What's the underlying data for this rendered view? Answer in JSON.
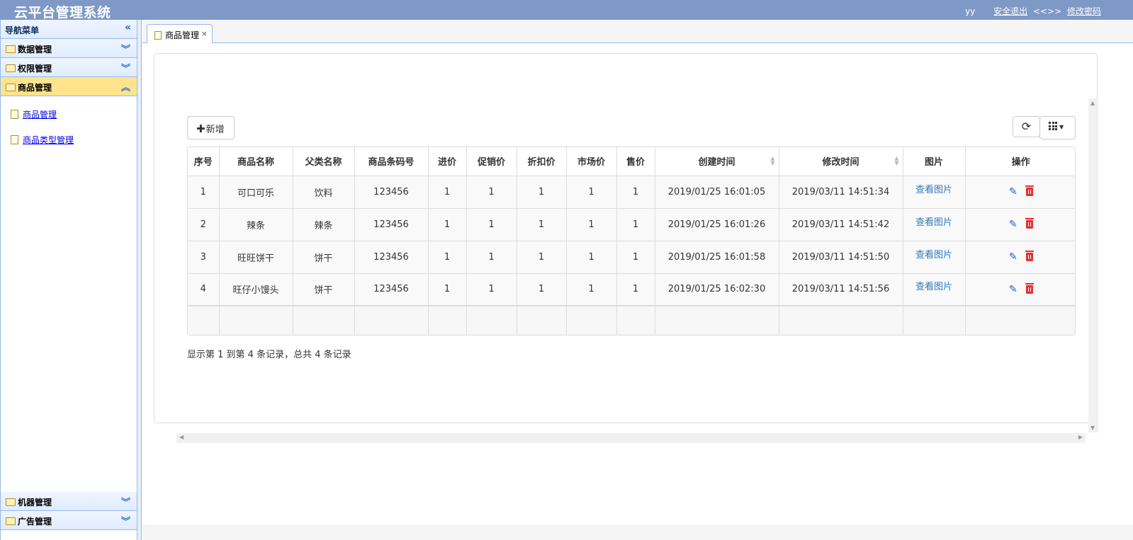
{
  "header": {
    "title": "云平台管理系统",
    "user": "yy",
    "logout": "安全退出",
    "separator": "<<>>",
    "change_password": "修改密码"
  },
  "sidebar": {
    "heading": "导航菜单",
    "sections": [
      {
        "label": "数据管理",
        "state": "collapsed"
      },
      {
        "label": "权限管理",
        "state": "collapsed"
      },
      {
        "label": "商品管理",
        "state": "expanded"
      },
      {
        "label": "机器管理",
        "state": "collapsed"
      },
      {
        "label": "广告管理",
        "state": "collapsed"
      }
    ],
    "items": [
      "商品管理",
      "商品类型管理"
    ]
  },
  "tabs": [
    {
      "label": "商品管理"
    }
  ],
  "toolbar": {
    "add_label": "新增"
  },
  "table": {
    "columns": [
      "序号",
      "商品名称",
      "父类名称",
      "商品条码号",
      "进价",
      "促销价",
      "折扣价",
      "市场价",
      "售价",
      "创建时间",
      "修改时间",
      "图片",
      "操作"
    ],
    "rows": [
      {
        "no": "1",
        "name": "可口可乐",
        "parent": "饮料",
        "barcode": "123456",
        "cost": "1",
        "promo": "1",
        "discount": "1",
        "market": "1",
        "sale": "1",
        "created": "2019/01/25 16:01:05",
        "modified": "2019/03/11 14:51:34",
        "pic": "查看图片"
      },
      {
        "no": "2",
        "name": "辣条",
        "parent": "辣条",
        "barcode": "123456",
        "cost": "1",
        "promo": "1",
        "discount": "1",
        "market": "1",
        "sale": "1",
        "created": "2019/01/25 16:01:26",
        "modified": "2019/03/11 14:51:42",
        "pic": "查看图片"
      },
      {
        "no": "3",
        "name": "旺旺饼干",
        "parent": "饼干",
        "barcode": "123456",
        "cost": "1",
        "promo": "1",
        "discount": "1",
        "market": "1",
        "sale": "1",
        "created": "2019/01/25 16:01:58",
        "modified": "2019/03/11 14:51:50",
        "pic": "查看图片"
      },
      {
        "no": "4",
        "name": "旺仔小馒头",
        "parent": "饼干",
        "barcode": "123456",
        "cost": "1",
        "promo": "1",
        "discount": "1",
        "market": "1",
        "sale": "1",
        "created": "2019/01/25 16:02:30",
        "modified": "2019/03/11 14:51:56",
        "pic": "查看图片"
      }
    ]
  },
  "pagination": {
    "summary": "显示第 1 到第 4 条记录，总共 4 条记录"
  },
  "icons": {
    "collapse": "double-chevron-left-icon",
    "section_collapsed": "double-chevron-down-icon",
    "section_expanded": "double-chevron-up-icon",
    "folder": "folder-icon",
    "doc": "document-icon",
    "refresh": "refresh-icon",
    "columns": "grid-icon",
    "edit": "pencil-icon",
    "delete": "trash-icon"
  },
  "colors": {
    "header_bg": "#7f99c6",
    "active_section": "#ffe48d",
    "link": "#337ab7",
    "delete": "#e53030"
  }
}
